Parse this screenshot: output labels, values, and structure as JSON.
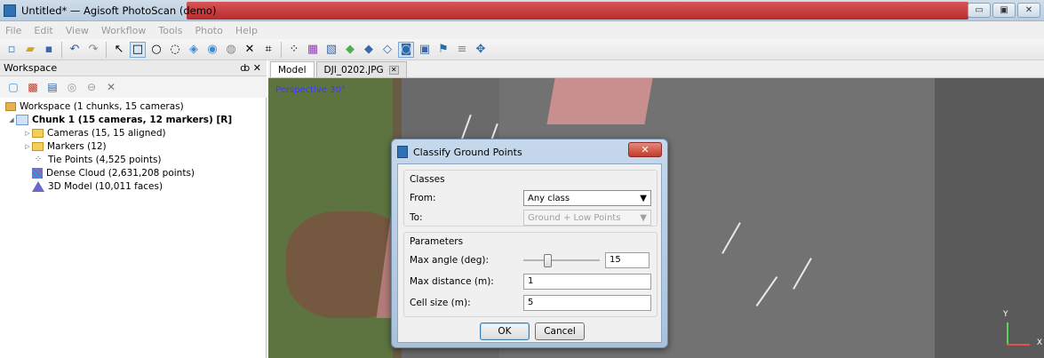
{
  "window": {
    "title": "Untitled* — Agisoft PhotoScan (demo)",
    "controls": [
      "▭",
      "▣",
      "✕"
    ]
  },
  "menu": [
    "File",
    "Edit",
    "View",
    "Workflow",
    "Tools",
    "Photo",
    "Help"
  ],
  "workspace": {
    "header": "Workspace",
    "header_controls": "ȸ ✕",
    "tree": {
      "root": "Workspace (1 chunks, 15 cameras)",
      "chunk": "Chunk 1 (15 cameras, 12 markers) [R]",
      "cameras": "Cameras (15, 15 aligned)",
      "markers": "Markers (12)",
      "tie_points": "Tie Points (4,525 points)",
      "dense_cloud": "Dense Cloud (2,631,208 points)",
      "model": "3D Model (10,011 faces)"
    }
  },
  "tabs": [
    {
      "label": "Model"
    },
    {
      "label": "DJI_0202.JPG"
    }
  ],
  "view": {
    "perspective": "Perspective 30°",
    "axis_y": "Y",
    "axis_x": "X"
  },
  "dialog": {
    "title": "Classify Ground Points",
    "close": "✕",
    "classes_group": "Classes",
    "from_label": "From:",
    "from_value": "Any class",
    "to_label": "To:",
    "to_value": "Ground + Low Points",
    "params_group": "Parameters",
    "max_angle_label": "Max angle (deg):",
    "max_angle_value": "15",
    "max_angle_fraction": 0.3,
    "max_distance_label": "Max distance (m):",
    "max_distance_value": "1",
    "cell_size_label": "Cell size (m):",
    "cell_size_value": "5",
    "ok": "OK",
    "cancel": "Cancel"
  }
}
